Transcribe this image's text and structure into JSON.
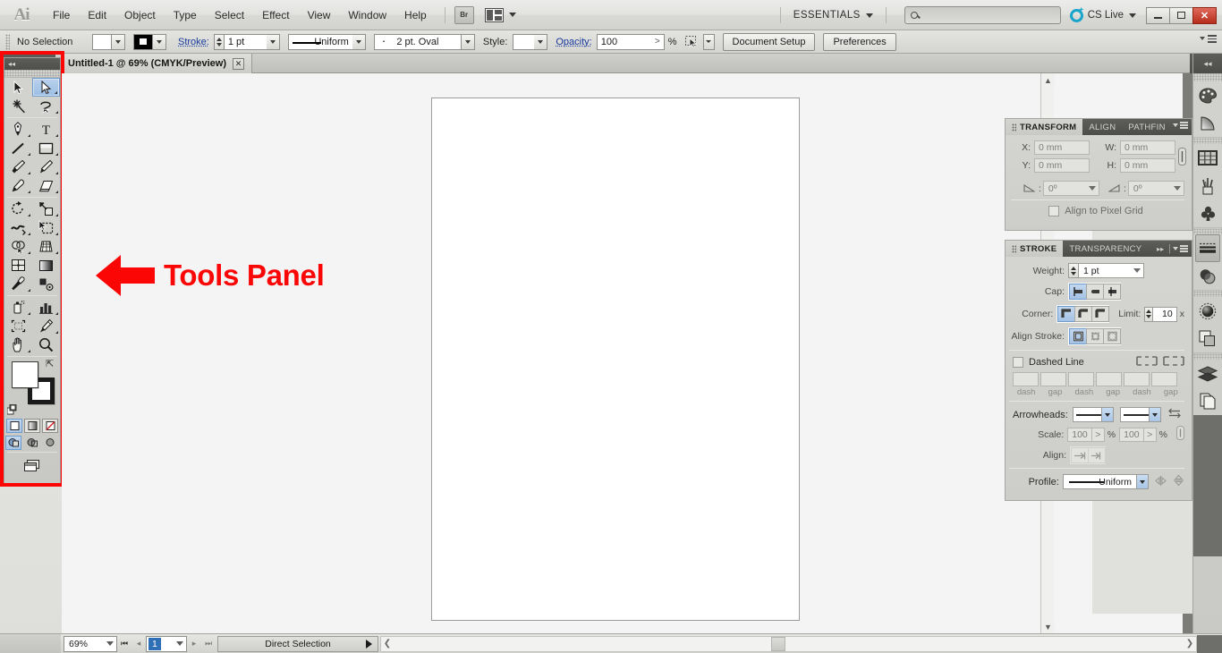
{
  "app": {
    "name": "Adobe Illustrator",
    "logo_text": "Ai"
  },
  "menubar": {
    "items": [
      "File",
      "Edit",
      "Object",
      "Type",
      "Select",
      "Effect",
      "View",
      "Window",
      "Help"
    ],
    "bridge_label": "Br",
    "arrange_label": "arrange-documents",
    "workspace": "ESSENTIALS",
    "search_placeholder": "",
    "search_value": "",
    "cslive_label": "CS Live",
    "window_buttons": {
      "minimize": "minimize",
      "maximize": "maximize",
      "close": "✕"
    }
  },
  "controlbar": {
    "selection_status": "No Selection",
    "fill_label": "fill-swatch",
    "stroke_color_label": "stroke-swatch",
    "stroke_label": "Stroke:",
    "stroke_weight": "1 pt",
    "variable_width_profile": "Uniform",
    "brush_definition": "2 pt. Oval",
    "style_label": "Style:",
    "opacity_label": "Opacity:",
    "opacity_value": "100",
    "opacity_unit": "%",
    "buttons": [
      "Document Setup",
      "Preferences"
    ]
  },
  "tabbar": {
    "document_title": "Untitled-1 @ 69% (CMYK/Preview)",
    "close_glyph": "✕"
  },
  "toolspanel": {
    "annotation_text": "Tools Panel",
    "annotation_color": "#fb0505",
    "highlight_border_color": "#fb0505",
    "rows": [
      [
        "selection-tool",
        "direct-selection-tool"
      ],
      [
        "magic-wand-tool",
        "lasso-tool"
      ],
      [
        "pen-tool",
        "type-tool"
      ],
      [
        "line-segment-tool",
        "rectangle-tool"
      ],
      [
        "paintbrush-tool",
        "pencil-tool"
      ],
      [
        "blob-brush-tool",
        "eraser-tool"
      ],
      [
        "rotate-tool",
        "scale-tool"
      ],
      [
        "width-tool",
        "free-transform-tool"
      ],
      [
        "shape-builder-tool",
        "perspective-grid-tool"
      ],
      [
        "mesh-tool",
        "gradient-tool"
      ],
      [
        "eyedropper-tool",
        "blend-tool"
      ],
      [
        "symbol-sprayer-tool",
        "column-graph-tool"
      ],
      [
        "artboard-tool",
        "slice-tool"
      ],
      [
        "hand-tool",
        "zoom-tool"
      ]
    ],
    "active_tool": "direct-selection-tool",
    "fill_color": "#ffffff",
    "stroke_color": "#000000",
    "paint_modes": [
      "color-mode",
      "gradient-mode",
      "none-mode"
    ],
    "draw_modes": [
      "draw-normal",
      "draw-behind",
      "draw-inside"
    ],
    "screen_mode": "change-screen-mode"
  },
  "panels": {
    "transform_group": {
      "tabs": [
        {
          "label": "TRANSFORM",
          "active": true
        },
        {
          "label": "ALIGN",
          "active": false
        },
        {
          "label": "PATHFIN",
          "active": false
        }
      ],
      "fields": {
        "x_label": "X:",
        "x_value": "0 mm",
        "y_label": "Y:",
        "y_value": "0 mm",
        "w_label": "W:",
        "w_value": "0 mm",
        "h_label": "H:",
        "h_value": "0 mm",
        "rotate_value": "0º",
        "shear_value": "0º"
      },
      "align_pixel_grid_label": "Align to Pixel Grid",
      "align_pixel_grid_checked": false
    },
    "stroke_group": {
      "tabs": [
        {
          "label": "STROKE",
          "active": true
        },
        {
          "label": "TRANSPARENCY",
          "active": false
        }
      ],
      "weight_label": "Weight:",
      "weight_value": "1 pt",
      "cap_label": "Cap:",
      "cap_options": [
        "butt-cap",
        "round-cap",
        "projecting-cap"
      ],
      "cap_selected": 0,
      "corner_label": "Corner:",
      "corner_options": [
        "miter-join",
        "round-join",
        "bevel-join"
      ],
      "corner_selected": 0,
      "limit_label": "Limit:",
      "limit_value": "10",
      "limit_unit": "x",
      "align_stroke_label": "Align Stroke:",
      "align_stroke_options": [
        "align-center",
        "align-inside",
        "align-outside"
      ],
      "align_stroke_selected": 0,
      "dashed_line_label": "Dashed Line",
      "dashed_line_checked": false,
      "dash_labels": [
        "dash",
        "gap",
        "dash",
        "gap",
        "dash",
        "gap"
      ],
      "dash_values": [
        "",
        "",
        "",
        "",
        "",
        ""
      ],
      "arrowheads_label": "Arrowheads:",
      "arrowhead_start": "none",
      "arrowhead_end": "none",
      "scale_label": "Scale:",
      "scale_start": "100",
      "scale_end": "100",
      "scale_unit": "%",
      "align_label": "Align:",
      "profile_label": "Profile:",
      "profile_value": "Uniform"
    }
  },
  "icondock": {
    "items": [
      {
        "name": "color-panel-icon"
      },
      {
        "name": "color-guide-panel-icon"
      },
      {
        "name": "swatches-panel-icon"
      },
      {
        "name": "brushes-panel-icon"
      },
      {
        "name": "symbols-panel-icon"
      },
      {
        "name": "stroke-panel-icon",
        "active": true
      },
      {
        "name": "transparency-panel-icon"
      },
      {
        "name": "appearance-panel-icon"
      },
      {
        "name": "graphic-styles-panel-icon"
      },
      {
        "name": "layers-panel-icon"
      },
      {
        "name": "artboards-panel-icon"
      }
    ]
  },
  "statusbar": {
    "zoom_level": "69%",
    "page_number": "1",
    "status_text": "Direct Selection",
    "nav_first": "first-page",
    "nav_prev": "previous-page",
    "nav_next": "next-page",
    "nav_last": "last-page"
  }
}
